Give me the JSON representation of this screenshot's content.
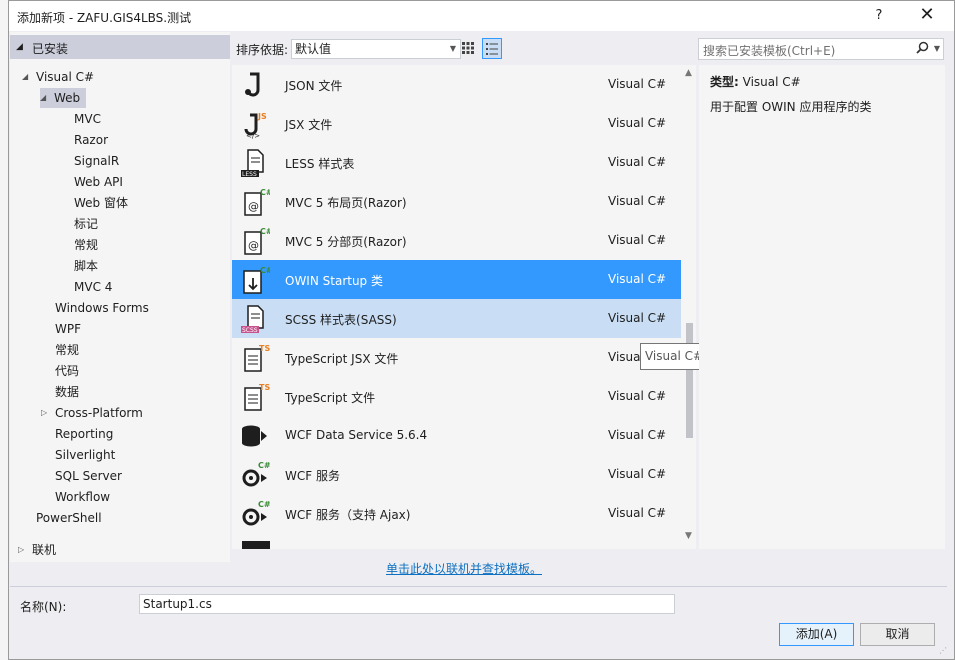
{
  "dialog": {
    "title": "添加新项 - ZAFU.GIS4LBS.测试",
    "help": "?",
    "close": "✕"
  },
  "tree": {
    "header": "已安装",
    "nodes": {
      "visual_csharp": "Visual C#",
      "web": "Web",
      "mvc": "MVC",
      "razor": "Razor",
      "signalr": "SignalR",
      "webapi": "Web API",
      "webform": "Web 窗体",
      "markup": "标记",
      "general_web": "常规",
      "script": "脚本",
      "mvc4": "MVC 4",
      "winforms": "Windows Forms",
      "wpf": "WPF",
      "general": "常规",
      "code": "代码",
      "data": "数据",
      "crossplatform": "Cross-Platform",
      "reporting": "Reporting",
      "silverlight": "Silverlight",
      "sqlserver": "SQL Server",
      "workflow": "Workflow",
      "powershell": "PowerShell",
      "online": "联机"
    }
  },
  "toolbar": {
    "sort_label": "排序依据:",
    "sort_value": "默认值",
    "search_placeholder": "搜索已安装模板(Ctrl+E)"
  },
  "templates": [
    {
      "name": "JSON 文件",
      "lang": "Visual C#",
      "icon": "json-file-icon"
    },
    {
      "name": "JSX 文件",
      "lang": "Visual C#",
      "icon": "jsx-file-icon"
    },
    {
      "name": "LESS 样式表",
      "lang": "Visual C#",
      "icon": "less-file-icon"
    },
    {
      "name": "MVC 5 布局页(Razor)",
      "lang": "Visual C#",
      "icon": "razor-layout-icon"
    },
    {
      "name": "MVC 5 分部页(Razor)",
      "lang": "Visual C#",
      "icon": "razor-partial-icon"
    },
    {
      "name": "OWIN Startup 类",
      "lang": "Visual C#",
      "icon": "owin-startup-icon"
    },
    {
      "name": "SCSS 样式表(SASS)",
      "lang": "Visual C#",
      "icon": "scss-file-icon"
    },
    {
      "name": "TypeScript JSX 文件",
      "lang": "Visual C#",
      "icon": "typescript-jsx-icon"
    },
    {
      "name": "TypeScript 文件",
      "lang": "Visual C#",
      "icon": "typescript-file-icon"
    },
    {
      "name": "WCF Data Service 5.6.4",
      "lang": "Visual C#",
      "icon": "wcf-data-service-icon"
    },
    {
      "name": "WCF 服务",
      "lang": "Visual C#",
      "icon": "wcf-service-icon"
    },
    {
      "name": "WCF 服务（支持 Ajax)",
      "lang": "Visual C#",
      "icon": "wcf-ajax-service-icon"
    }
  ],
  "tooltip": "Visual C#",
  "online_link": "单击此处以联机并查找模板。",
  "description": {
    "type_label": "类型:",
    "type_value": "Visual C#",
    "text": "用于配置 OWIN 应用程序的类"
  },
  "footer": {
    "name_label": "名称(N):",
    "name_value": "Startup1.cs",
    "add_button": "添加(A)",
    "cancel_button": "取消"
  },
  "colors": {
    "selection": "#3399ff",
    "hover": "#c9def5",
    "link": "#0e70c0",
    "header_bg": "#cccedb"
  }
}
